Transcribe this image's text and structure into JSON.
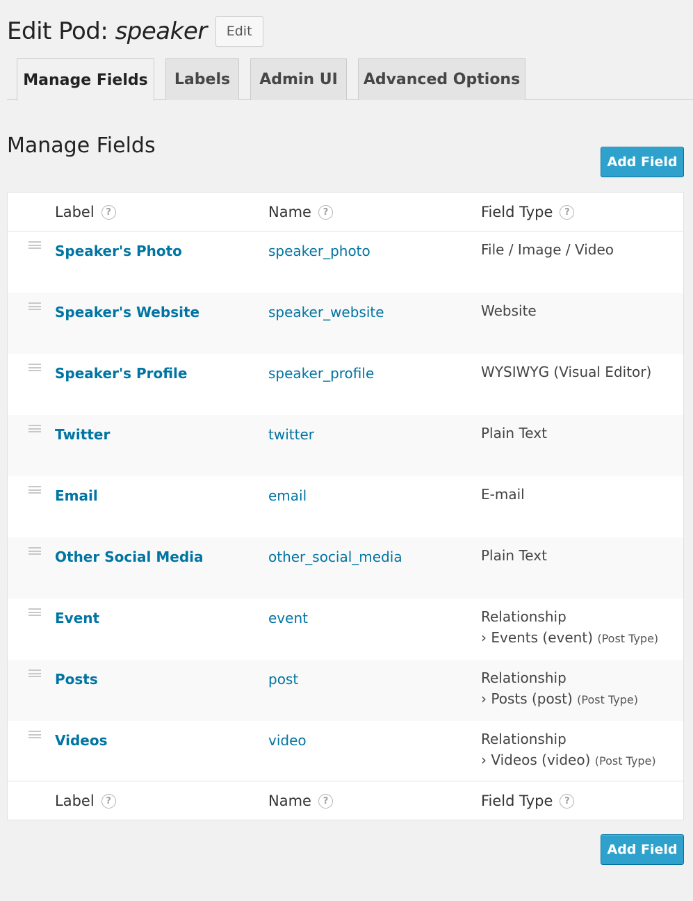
{
  "header": {
    "title_prefix": "Edit Pod:",
    "pod_name": "speaker",
    "edit_label": "Edit"
  },
  "tabs": [
    {
      "label": "Manage Fields",
      "active": true
    },
    {
      "label": "Labels",
      "active": false
    },
    {
      "label": "Admin UI",
      "active": false
    },
    {
      "label": "Advanced Options",
      "active": false
    }
  ],
  "section": {
    "title": "Manage Fields",
    "add_field_label": "Add Field"
  },
  "table": {
    "columns": [
      "Label",
      "Name",
      "Field Type"
    ],
    "help_icon": "help-circle-icon",
    "rows": [
      {
        "label": "Speaker's Photo",
        "name": "speaker_photo",
        "type": "File / Image / Video"
      },
      {
        "label": "Speaker's Website",
        "name": "speaker_website",
        "type": "Website"
      },
      {
        "label": "Speaker's Profile",
        "name": "speaker_profile",
        "type": "WYSIWYG (Visual Editor)"
      },
      {
        "label": "Twitter",
        "name": "twitter",
        "type": "Plain Text"
      },
      {
        "label": "Email",
        "name": "email",
        "type": "E-mail"
      },
      {
        "label": "Other Social Media",
        "name": "other_social_media",
        "type": "Plain Text"
      },
      {
        "label": "Event",
        "name": "event",
        "type": "Relationship",
        "related": "› Events (event)",
        "related_kind": "(Post Type)"
      },
      {
        "label": "Posts",
        "name": "post",
        "type": "Relationship",
        "related": "› Posts (post)",
        "related_kind": "(Post Type)"
      },
      {
        "label": "Videos",
        "name": "video",
        "type": "Relationship",
        "related": "› Videos (video)",
        "related_kind": "(Post Type)"
      }
    ]
  },
  "colors": {
    "link": "#0074a2",
    "primary_button": "#2ea2cc",
    "background": "#f1f1f1"
  }
}
